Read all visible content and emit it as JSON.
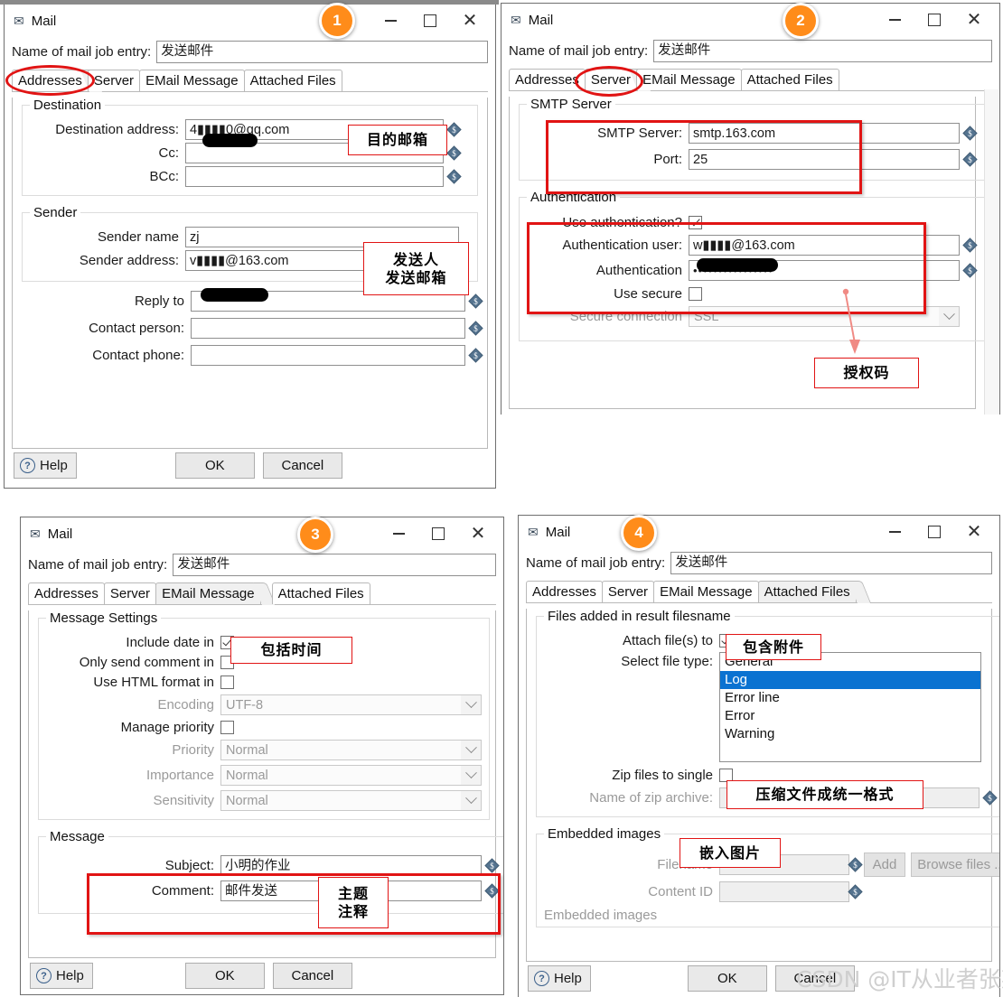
{
  "common": {
    "window_title": "Mail",
    "mail_icon": "envelope-icon",
    "minimize": "–",
    "maximize": "□",
    "close": "✕",
    "job_label": "Name of mail job entry:",
    "job_value": "发送邮件",
    "tabs": [
      "Addresses",
      "Server",
      "EMail Message",
      "Attached Files"
    ],
    "ok": "OK",
    "cancel": "Cancel",
    "help": "Help",
    "dollar_icon": "variable-dollar-icon"
  },
  "colors": {
    "accent_orange": "#ff8c1a",
    "annotation_red": "#e11414",
    "selection_blue": "#0a72d1",
    "disabled_gray": "#9a9a9a"
  },
  "window1": {
    "badge": "1",
    "active_tab": "Addresses",
    "groups": {
      "destination": {
        "legend": "Destination",
        "rows": [
          {
            "label": "Destination address:",
            "value": "4▮▮▮▮0@qq.com",
            "redacted": true
          },
          {
            "label": "Cc:",
            "value": ""
          },
          {
            "label": "BCc:",
            "value": ""
          }
        ]
      },
      "sender": {
        "legend": "Sender",
        "rows": [
          {
            "label": "Sender name",
            "value": "zj"
          },
          {
            "label": "Sender address:",
            "value": "v▮▮▮▮@163.com",
            "redacted": true
          }
        ]
      },
      "extra_rows": [
        {
          "label": "Reply to",
          "value": ""
        },
        {
          "label": "Contact person:",
          "value": ""
        },
        {
          "label": "Contact phone:",
          "value": ""
        }
      ]
    },
    "annotations": [
      {
        "text": "目的邮箱"
      }
    ],
    "annotation2_line1": "发送人",
    "annotation2_line2": "发送邮箱"
  },
  "window2": {
    "badge": "2",
    "active_tab": "Server",
    "groups": {
      "smtp": {
        "legend": "SMTP Server",
        "rows": [
          {
            "label": "SMTP Server:",
            "value": "smtp.163.com"
          },
          {
            "label": "Port:",
            "value": "25"
          }
        ]
      },
      "auth": {
        "legend": "Authentication",
        "use_auth_label": "Use authentication?",
        "use_auth_checked": true,
        "user_label": "Authentication user:",
        "user_value": "w▮▮▮▮@163.com",
        "password_label": "Authentication",
        "password_value": "••••••••••••••••",
        "use_secure_label": "Use secure",
        "use_secure_checked": false,
        "secure_conn_label": "Secure connection",
        "secure_conn_value": "SSL"
      }
    },
    "annotation": "授权码"
  },
  "window3": {
    "badge": "3",
    "active_tab": "EMail Message",
    "groups": {
      "message_settings": {
        "legend": "Message Settings",
        "checks": [
          {
            "label": "Include date in",
            "checked": true
          },
          {
            "label": "Only send comment in",
            "checked": false
          },
          {
            "label": "Use HTML format in",
            "checked": false
          }
        ],
        "encoding_label": "Encoding",
        "encoding_value": "UTF-8",
        "manage_priority_label": "Manage priority",
        "manage_priority_checked": false,
        "selects": [
          {
            "label": "Priority",
            "value": "Normal"
          },
          {
            "label": "Importance",
            "value": "Normal"
          },
          {
            "label": "Sensitivity",
            "value": "Normal"
          }
        ]
      },
      "message": {
        "legend": "Message",
        "rows": [
          {
            "label": "Subject:",
            "value": "小明的作业"
          },
          {
            "label": "Comment:",
            "value": "邮件发送"
          }
        ]
      }
    },
    "annotation_date": "包括时间",
    "annotation_subject_line1": "主题",
    "annotation_subject_line2": "注释"
  },
  "window4": {
    "badge": "4",
    "active_tab": "Attached Files",
    "groups": {
      "files": {
        "legend": "Files added in result filesname",
        "attach_label": "Attach file(s) to",
        "attach_checked": true,
        "file_type_label": "Select file type:",
        "file_types": [
          "General",
          "Log",
          "Error line",
          "Error",
          "Warning"
        ],
        "file_type_selected": "Log",
        "zip_label": "Zip files to single",
        "zip_checked": false,
        "zip_name_label": "Name of zip archive:",
        "zip_name_value": ""
      },
      "embedded": {
        "legend": "Embedded images",
        "filename_label": "Filename",
        "filename_value": "",
        "add_button": "Add",
        "browse_button": "Browse files ...",
        "content_id_label": "Content ID",
        "content_id_value": "",
        "footer_legend": "Embedded images"
      }
    },
    "annotation_attach": "包含附件",
    "annotation_zip": "压缩文件成统一格式",
    "annotation_embedded": "嵌入图片"
  },
  "watermark": {
    "text": "CSDN @IT从业者张某某"
  }
}
